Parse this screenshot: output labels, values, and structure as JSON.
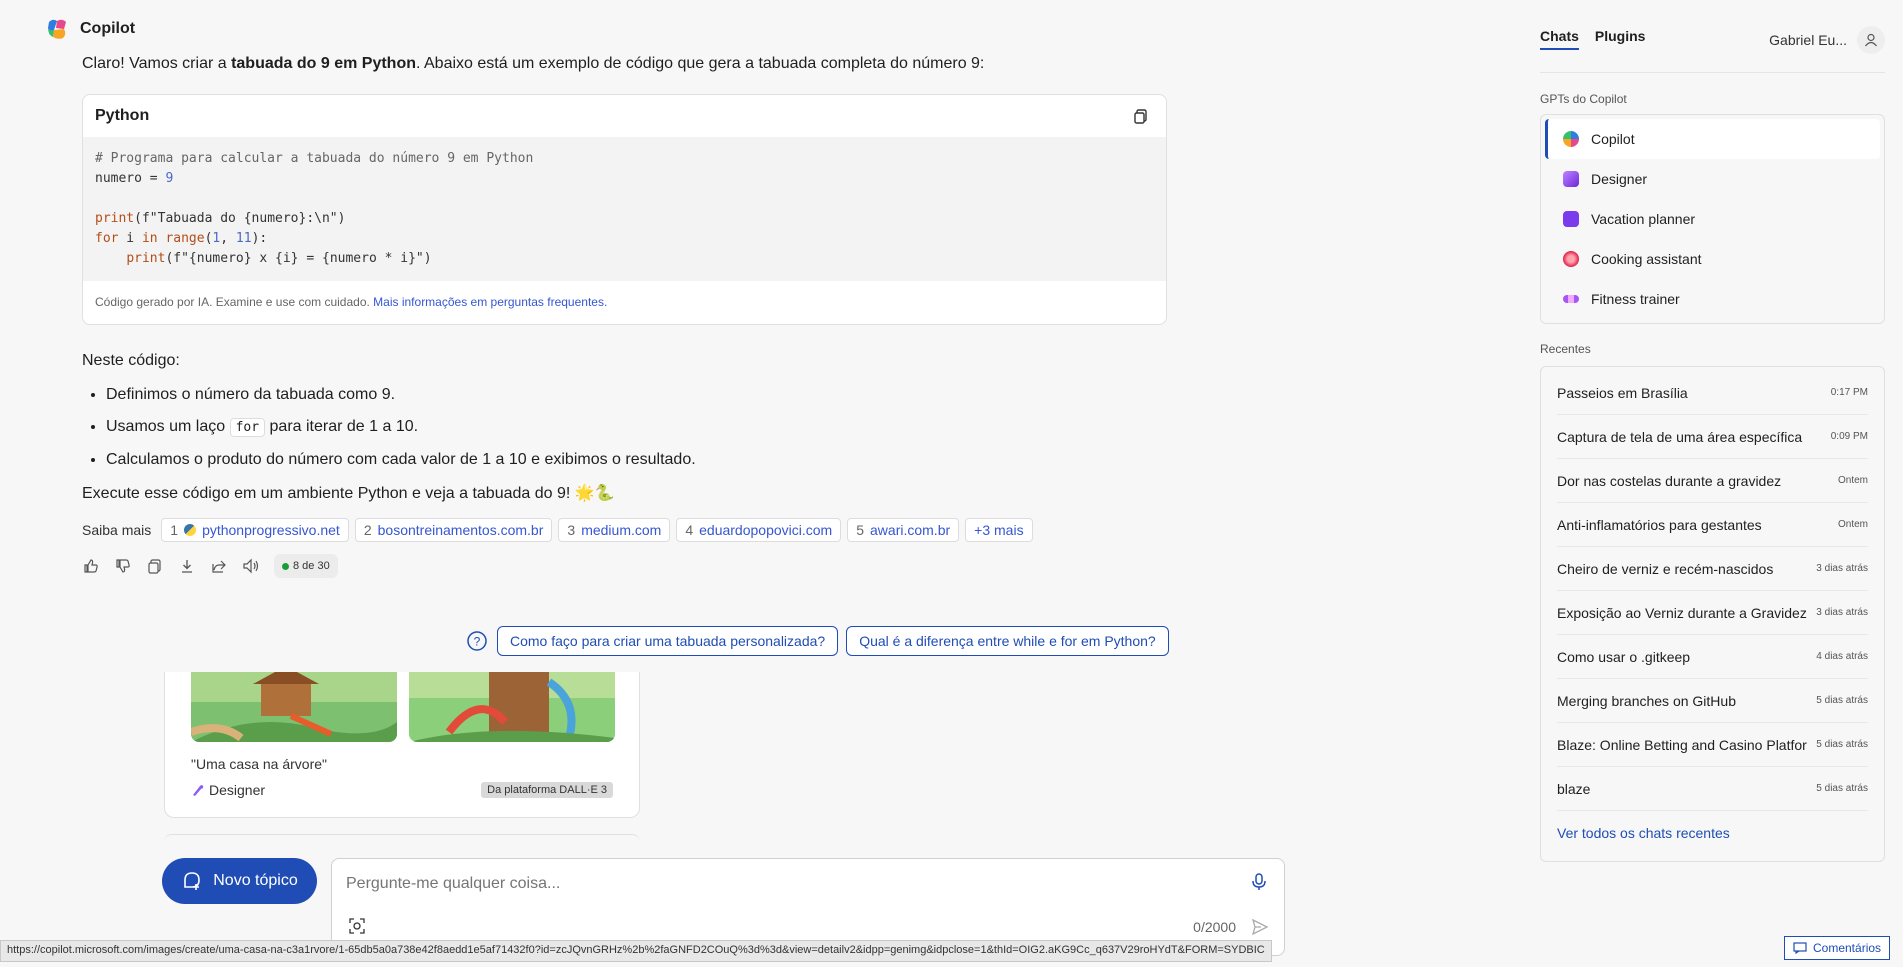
{
  "bot": {
    "name": "Copilot"
  },
  "answer": {
    "intro_before": "Claro! Vamos criar a ",
    "intro_bold": "tabuada do 9 em Python",
    "intro_after": ". Abaixo está um exemplo de código que gera a tabuada completa do número 9:",
    "code": {
      "language": "Python",
      "line1": "# Programa para calcular a tabuada do número 9 em Python",
      "line2a": "numero = ",
      "line2b": "9",
      "line4a": "print",
      "line4b": "(f\"Tabuada do {numero}:\\n\")",
      "line5a": "for",
      "line5b": " i ",
      "line5c": "in",
      "line5d": " ",
      "line5e": "range",
      "line5f": "(",
      "line5g": "1",
      "line5h": ", ",
      "line5i": "11",
      "line5j": "):",
      "line6a": "    ",
      "line6b": "print",
      "line6c": "(f\"{numero} x {i} = {numero * i}\")",
      "footer_text": "Código gerado por IA. Examine e use com cuidado. ",
      "footer_link": "Mais informações em perguntas frequentes."
    },
    "explain_title": "Neste código:",
    "points": [
      {
        "text": "Definimos o número da tabuada como 9."
      },
      {
        "before": "Usamos um laço ",
        "code": "for",
        "after": " para iterar de 1 a 10."
      },
      {
        "text": "Calculamos o produto do número com cada valor de 1 a 10 e exibimos o resultado."
      }
    ],
    "execute": "Execute esse código em um ambiente Python e veja a tabuada do 9! 🌟🐍",
    "learn_more_label": "Saiba mais",
    "sources": [
      {
        "num": "1",
        "site": "pythonprogressivo.net"
      },
      {
        "num": "2",
        "site": "bosontreinamentos.com.br"
      },
      {
        "num": "3",
        "site": "medium.com"
      },
      {
        "num": "4",
        "site": "eduardopopovici.com"
      },
      {
        "num": "5",
        "site": "awari.com.br"
      }
    ],
    "more_sources": "+3 mais",
    "counter": "8 de 30"
  },
  "suggestions": [
    "Como faço para criar uma tabuada personalizada?",
    "Qual é a diferença entre while e for em Python?"
  ],
  "previous_card": {
    "caption": "\"Uma casa na árvore\"",
    "designer": "Designer",
    "badge": "Da plataforma DALL·E 3"
  },
  "composer": {
    "new_topic": "Novo tópico",
    "placeholder": "Pergunte-me qualquer coisa...",
    "char_count": "0/2000"
  },
  "status_url": "https://copilot.microsoft.com/images/create/uma-casa-na-c3a1rvore/1-65db5a0a738e42f8aedd1e5af71432f0?id=zcJQvnGRHz%2b%2faGNFD2COuQ%3d%3d&view=detailv2&idpp=genimg&idpclose=1&thId=OIG2.aKG9Cc_q637V29roHYdT&FORM=SYDBIC",
  "feedback": "Comentários",
  "sidebar": {
    "tabs": [
      "Chats",
      "Plugins"
    ],
    "user_name": "Gabriel Eu...",
    "gpts_label": "GPTs do Copilot",
    "gpts": [
      {
        "label": "Copilot",
        "color": "#3b82f6"
      },
      {
        "label": "Designer",
        "color": "#8b5cf6"
      },
      {
        "label": "Vacation planner",
        "color": "#7c3aed"
      },
      {
        "label": "Cooking assistant",
        "color": "#e11d48"
      },
      {
        "label": "Fitness trainer",
        "color": "#a855f7"
      }
    ],
    "recent_label": "Recentes",
    "recents": [
      {
        "title": "Passeios em Brasília",
        "time": "0:17 PM"
      },
      {
        "title": "Captura de tela de uma área específica",
        "time": "0:09 PM"
      },
      {
        "title": "Dor nas costelas durante a gravidez",
        "time": "Ontem"
      },
      {
        "title": "Anti-inflamatórios para gestantes",
        "time": "Ontem"
      },
      {
        "title": "Cheiro de verniz e recém-nascidos",
        "time": "3 dias atrás"
      },
      {
        "title": "Exposição ao Verniz durante a Gravidez",
        "time": "3 dias atrás"
      },
      {
        "title": "Como usar o .gitkeep",
        "time": "4 dias atrás"
      },
      {
        "title": "Merging branches on GitHub",
        "time": "5 dias atrás"
      },
      {
        "title": "Blaze: Online Betting and Casino Platform",
        "time": "5 dias atrás"
      },
      {
        "title": "blaze",
        "time": "5 dias atrás"
      }
    ],
    "see_all": "Ver todos os chats recentes"
  }
}
